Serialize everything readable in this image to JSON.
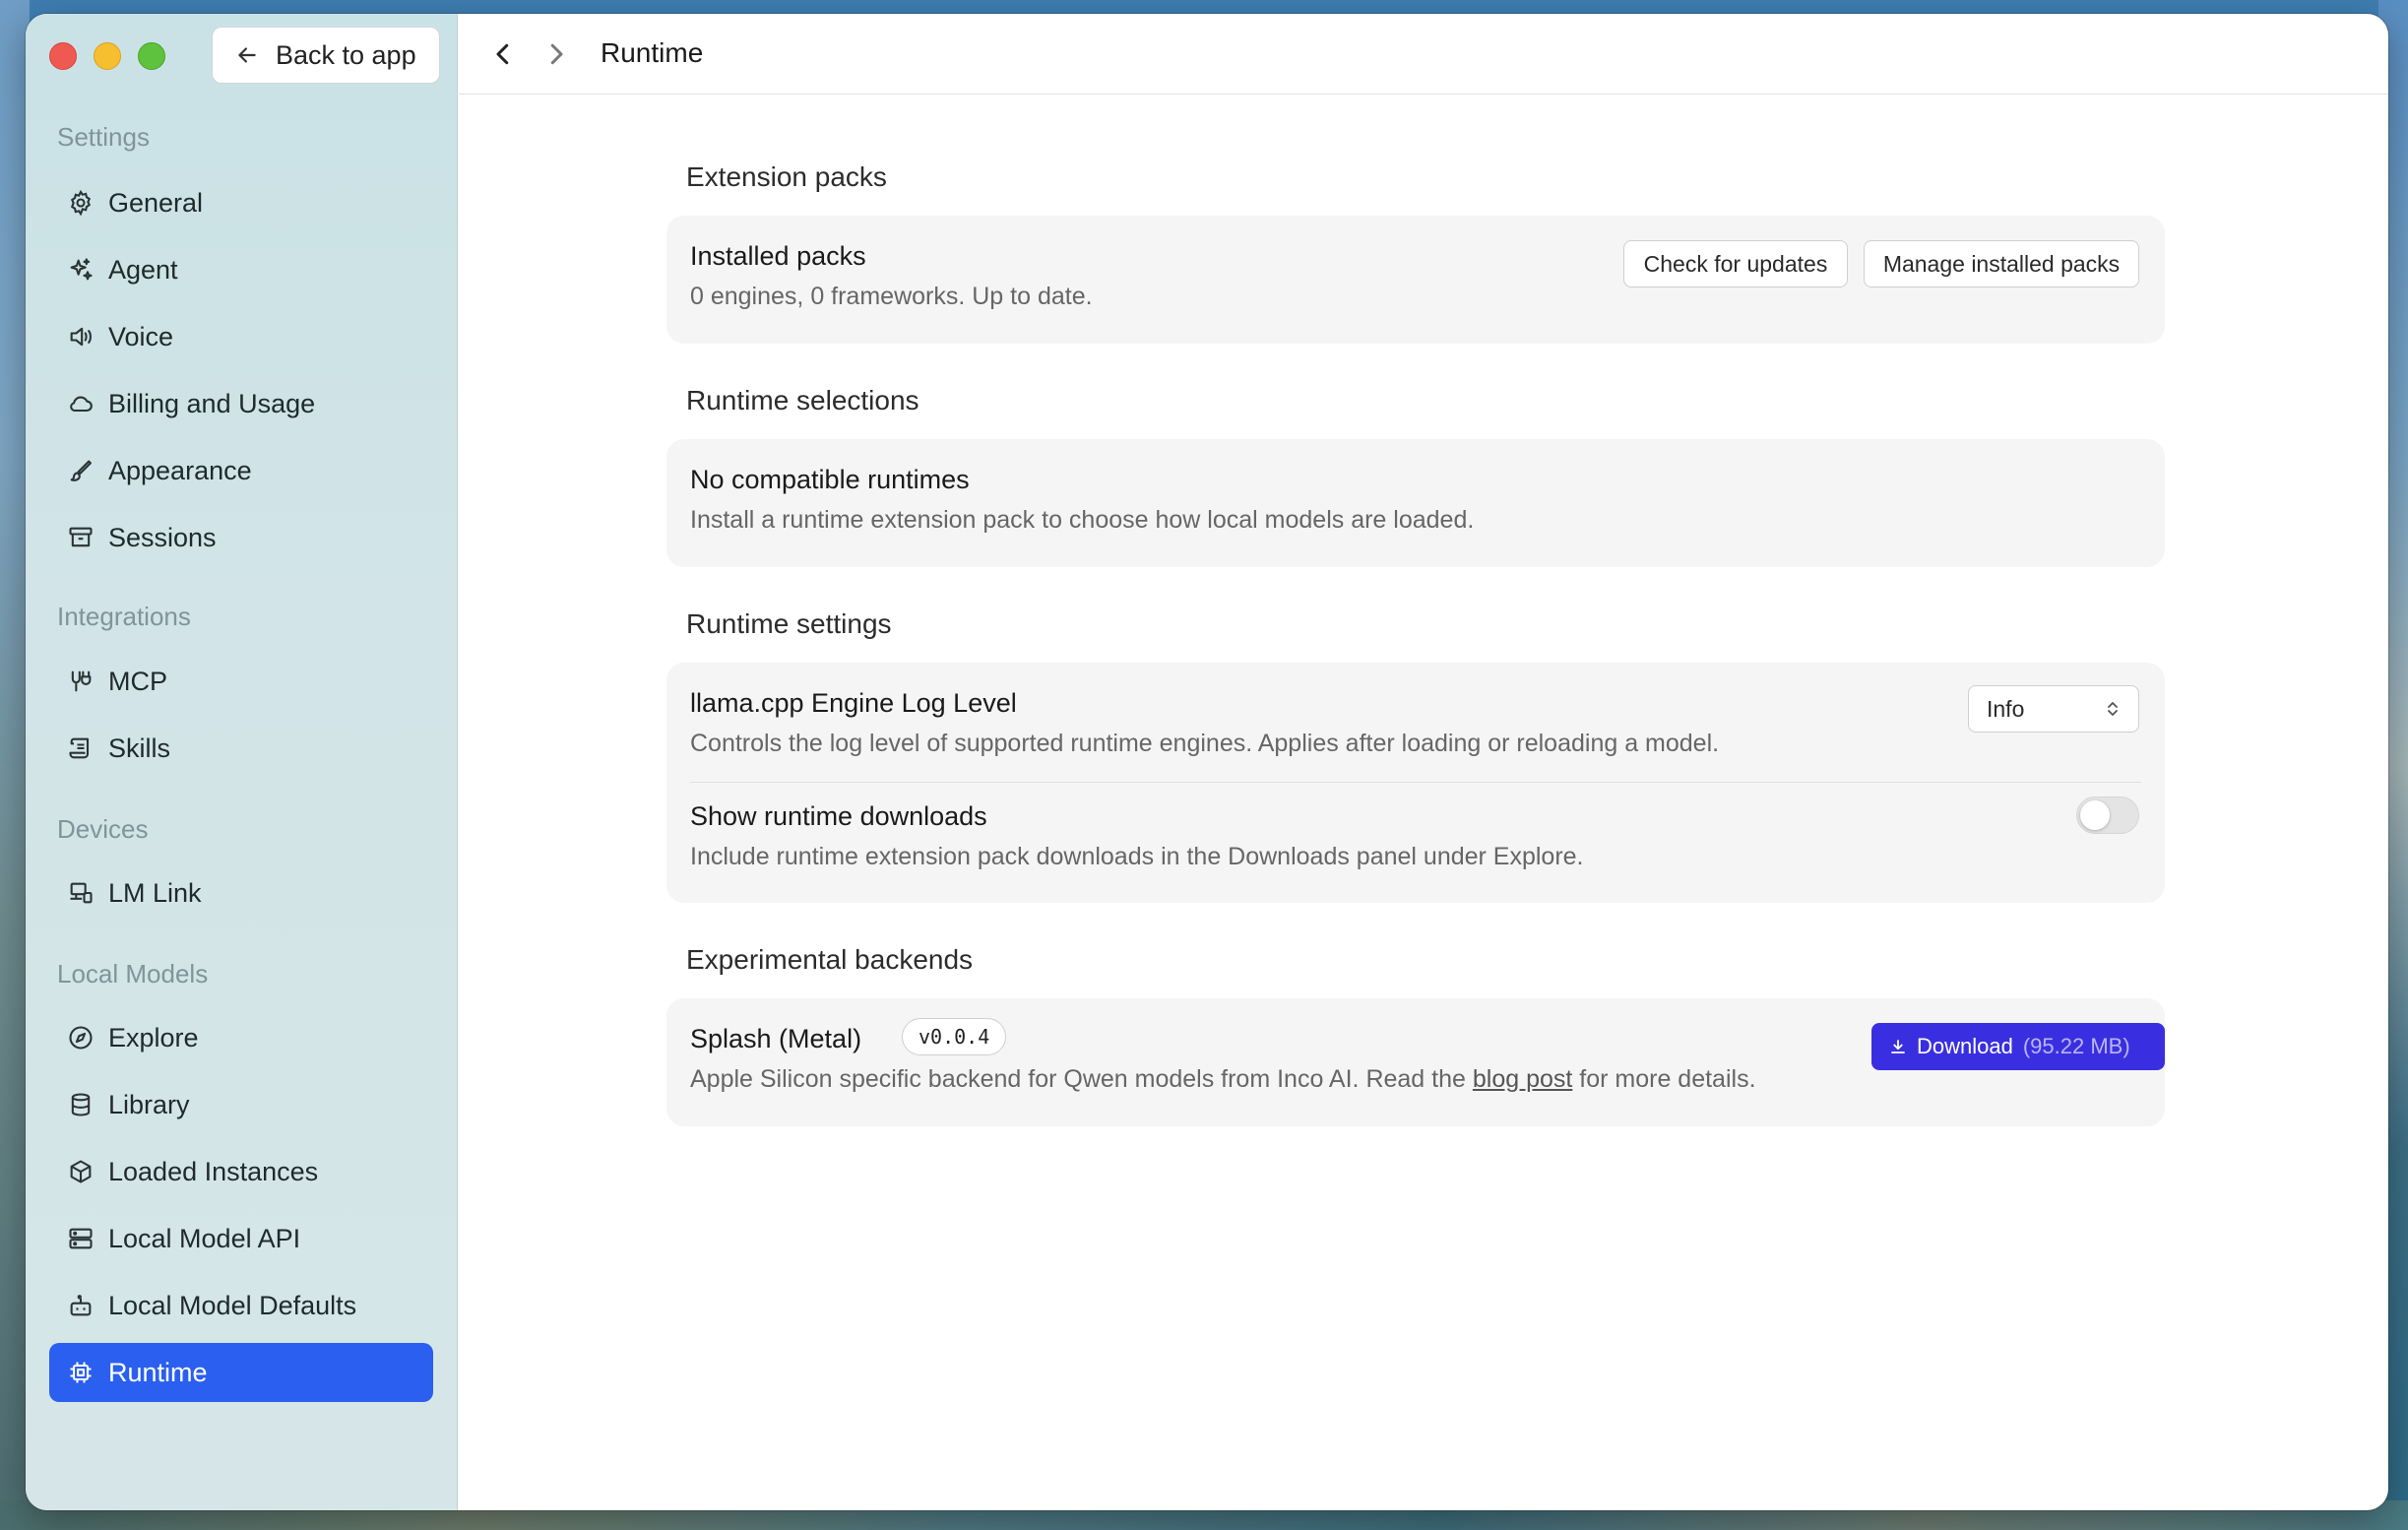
{
  "window": {
    "back_label": "Back to app",
    "page_title": "Runtime"
  },
  "sidebar": {
    "groups": [
      {
        "label": "Settings",
        "items": [
          {
            "label": "General",
            "icon": "gear-icon"
          },
          {
            "label": "Agent",
            "icon": "sparkles-icon"
          },
          {
            "label": "Voice",
            "icon": "speaker-icon"
          },
          {
            "label": "Billing and Usage",
            "icon": "cloud-icon"
          },
          {
            "label": "Appearance",
            "icon": "brush-icon"
          },
          {
            "label": "Sessions",
            "icon": "archive-icon"
          }
        ]
      },
      {
        "label": "Integrations",
        "items": [
          {
            "label": "MCP",
            "icon": "plug-icon"
          },
          {
            "label": "Skills",
            "icon": "scroll-icon"
          }
        ]
      },
      {
        "label": "Devices",
        "items": [
          {
            "label": "LM Link",
            "icon": "devices-link-icon"
          }
        ]
      },
      {
        "label": "Local Models",
        "items": [
          {
            "label": "Explore",
            "icon": "compass-icon"
          },
          {
            "label": "Library",
            "icon": "database-icon"
          },
          {
            "label": "Loaded Instances",
            "icon": "cube-icon"
          },
          {
            "label": "Local Model API",
            "icon": "server-icon"
          },
          {
            "label": "Local Model Defaults",
            "icon": "robot-icon"
          },
          {
            "label": "Runtime",
            "icon": "chip-icon",
            "active": true
          }
        ]
      }
    ]
  },
  "main": {
    "extension_packs": {
      "title": "Extension packs",
      "row_title": "Installed packs",
      "row_desc": "0 engines, 0 frameworks. Up to date.",
      "check_updates": "Check for updates",
      "manage_packs": "Manage installed packs"
    },
    "runtime_selections": {
      "title": "Runtime selections",
      "row_title": "No compatible runtimes",
      "row_desc": "Install a runtime extension pack to choose how local models are loaded."
    },
    "runtime_settings": {
      "title": "Runtime settings",
      "log_level_title": "llama.cpp Engine Log Level",
      "log_level_desc": "Controls the log level of supported runtime engines. Applies after loading or reloading a model.",
      "log_level_value": "Info",
      "downloads_title": "Show runtime downloads",
      "downloads_desc": "Include runtime extension pack downloads in the Downloads panel under Explore.",
      "downloads_enabled": false
    },
    "experimental": {
      "title": "Experimental backends",
      "name": "Splash (Metal)",
      "version": "v0.0.4",
      "desc_before": "Apple Silicon specific backend for Qwen models from Inco AI. Read the ",
      "link": "blog post",
      "desc_after": " for more details.",
      "download_label": "Download",
      "download_size": "(95.22 MB)"
    }
  },
  "colors": {
    "accent": "#2a5ff0",
    "download": "#3a2fe0"
  }
}
